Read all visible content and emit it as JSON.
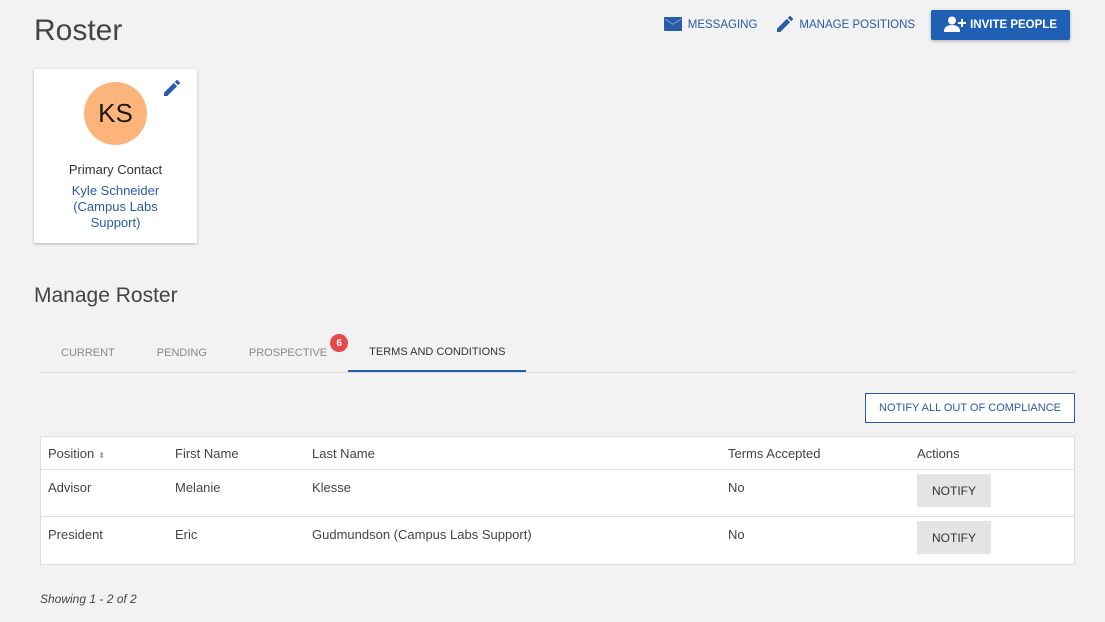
{
  "page": {
    "title": "Roster"
  },
  "toolbar": {
    "messaging_label": "MESSAGING",
    "manage_positions_label": "MANAGE POSITIONS",
    "invite_people_label": "INVITE PEOPLE"
  },
  "contact": {
    "initials": "KS",
    "role": "Primary Contact",
    "name": "Kyle Schneider (Campus Labs Support)",
    "avatar_color": "#fdb47a"
  },
  "section": {
    "title": "Manage Roster"
  },
  "tabs": [
    {
      "label": "CURRENT",
      "active": false
    },
    {
      "label": "PENDING",
      "active": false
    },
    {
      "label": "PROSPECTIVE",
      "active": false,
      "badge": "6"
    },
    {
      "label": "TERMS AND CONDITIONS",
      "active": true
    }
  ],
  "notify_all_label": "NOTIFY ALL OUT OF COMPLIANCE",
  "table": {
    "headers": [
      "Position",
      "First Name",
      "Last Name",
      "Terms Accepted",
      "Actions"
    ],
    "sort_glyph": "⬍",
    "rows": [
      {
        "position": "Advisor",
        "first": "Melanie",
        "last": "Klesse",
        "accepted": "No",
        "action": "NOTIFY"
      },
      {
        "position": "President",
        "first": "Eric",
        "last": "Gudmundson (Campus Labs Support)",
        "accepted": "No",
        "action": "NOTIFY"
      }
    ]
  },
  "footer": {
    "showing": "Showing 1 - 2 of 2"
  },
  "colors": {
    "accent": "#2a5ba8",
    "primary_button": "#1f5fb4",
    "badge": "#e8474b"
  },
  "icons": {
    "messaging": "envelope-icon",
    "manage": "pencil-icon",
    "invite": "add-user-icon",
    "edit": "pencil-icon"
  }
}
